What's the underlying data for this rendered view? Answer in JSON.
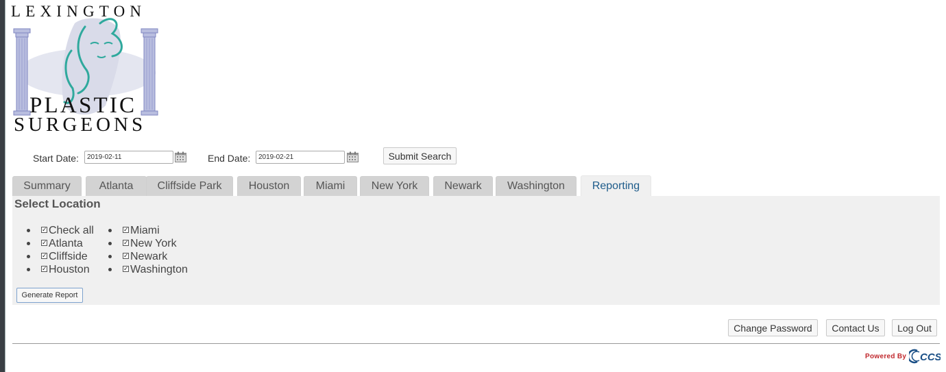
{
  "logo": {
    "line1": "LEXINGTON",
    "line2": "PLASTIC",
    "line3": "SURGEONS"
  },
  "search": {
    "start_label": "Start Date:",
    "start_value": "2019-02-11",
    "end_label": "End Date:",
    "end_value": "2019-02-21",
    "submit_label": "Submit Search"
  },
  "tabs": [
    {
      "label": "Summary"
    },
    {
      "label": "Atlanta"
    },
    {
      "label": "Cliffside Park"
    },
    {
      "label": "Houston"
    },
    {
      "label": "Miami"
    },
    {
      "label": "New York"
    },
    {
      "label": "Newark"
    },
    {
      "label": "Washington"
    },
    {
      "label": "Reporting",
      "active": true
    }
  ],
  "panel": {
    "title": "Select Location",
    "locations_col1": [
      {
        "label": "Check all",
        "checked": true
      },
      {
        "label": "Atlanta",
        "checked": true
      },
      {
        "label": "Cliffside",
        "checked": true
      },
      {
        "label": "Houston",
        "checked": true
      }
    ],
    "locations_col2": [
      {
        "label": "Miami",
        "checked": true
      },
      {
        "label": "New York",
        "checked": true
      },
      {
        "label": "Newark",
        "checked": true
      },
      {
        "label": "Washington",
        "checked": true
      }
    ],
    "generate_label": "Generate Report"
  },
  "footer": {
    "change_password": "Change Password",
    "contact_us": "Contact Us",
    "log_out": "Log Out",
    "powered_by": "Powered By",
    "brand": "CCS"
  },
  "colors": {
    "active_tab_text": "#1d5b8a",
    "tab_bg": "#d3d3d3",
    "panel_bg": "#f0f0f0",
    "powered_red": "#c0282d",
    "logo_teal": "#2fa99d",
    "logo_column": "#8a93c9"
  },
  "icons": [
    "calendar-icon",
    "checkbox-checked-icon",
    "ccs-logo-icon"
  ]
}
